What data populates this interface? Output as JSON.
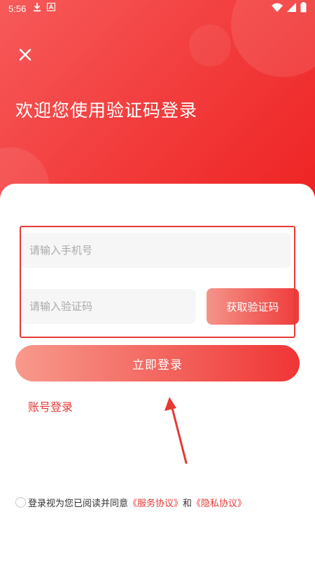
{
  "status_bar": {
    "time": "5:56",
    "left_icons": [
      "download-icon",
      "font-app-icon"
    ],
    "right_icons": [
      "wifi-icon",
      "signal-icon",
      "battery-icon"
    ]
  },
  "header": {
    "title": "欢迎您使用验证码登录",
    "close_icon": "close-icon",
    "background_colors": [
      "#f75a5a",
      "#ee2222"
    ]
  },
  "form": {
    "phone_placeholder": "请输入手机号",
    "phone_value": "",
    "code_placeholder": "请输入验证码",
    "code_value": "",
    "get_code_label": "获取验证码",
    "login_label": "立即登录",
    "account_login_label": "账号登录"
  },
  "agreement": {
    "checked": false,
    "prefix": "登录视为您已阅读并同意",
    "service_link": "《服务协议》",
    "connector": "和",
    "privacy_link": "《隐私协议》"
  },
  "colors": {
    "accent": "#e53935",
    "input_bg": "#f6f6f6",
    "placeholder": "#a9a9a9"
  }
}
